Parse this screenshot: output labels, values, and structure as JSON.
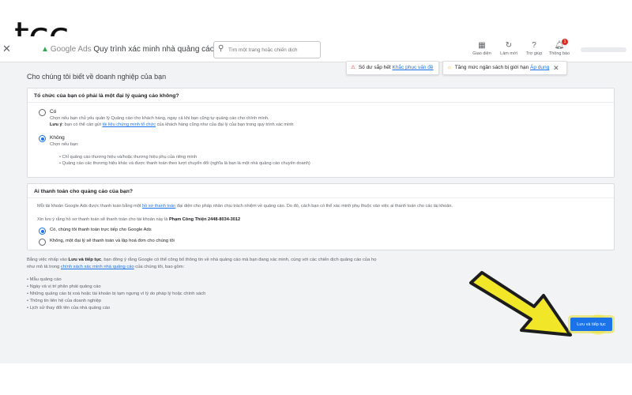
{
  "logo": "tcc",
  "appbar": {
    "brand": "Google Ads",
    "title": "Quy trình xác minh nhà quảng cáo",
    "search_placeholder": "Tìm một trang hoặc chiến dịch",
    "tools": [
      {
        "label": "Giao diện",
        "icon": "layout-icon"
      },
      {
        "label": "Làm mới",
        "icon": "refresh-icon"
      },
      {
        "label": "Trợ giúp",
        "icon": "help-icon"
      },
      {
        "label": "Thông báo",
        "icon": "bell-icon",
        "badge": "1"
      }
    ]
  },
  "alerts": {
    "balance": {
      "text": "Số dư sắp hết",
      "link": "Khắc phục vấn đề"
    },
    "budget": {
      "text": "Tăng mức ngân sách bị giới hạn",
      "link": "Áp dụng"
    }
  },
  "section_title": "Cho chúng tôi biết về doanh nghiệp của bạn",
  "card1": {
    "question": "Tổ chức của bạn có phải là một đại lý quảng cáo không?",
    "options": [
      {
        "label": "Có",
        "selected": false,
        "desc": "Chọn nếu bạn chủ yếu quản lý Quảng cáo cho khách hàng, ngay cả khi bạn cũng tự quảng cáo cho chính mình.",
        "note_label": "Lưu ý",
        "note_pre": ": bạn có thể cần gửi ",
        "note_link": "tài liệu chứng minh tổ chức",
        "note_post": " của khách hàng cũng như của đại lý của bạn trong quy trình xác minh"
      },
      {
        "label": "Không",
        "selected": true,
        "desc": "Chọn nếu bạn:",
        "bullets": [
          "• Chỉ quảng cáo thương hiệu và/hoặc thương hiệu phụ của riêng mình",
          "• Quảng cáo các thương hiệu khác và được thanh toán theo lượt chuyển đổi (nghĩa là bạn là một nhà quảng cáo chuyên doanh)"
        ]
      }
    ]
  },
  "card2": {
    "question": "Ai thanh toán cho quảng cáo của bạn?",
    "desc_pre": "Mỗi tài khoản Google Ads được thanh toán bằng một ",
    "desc_link": "hồ sơ thanh toán",
    "desc_post": " đại diện cho pháp nhân chịu trách nhiệm về quảng cáo. Do đó, cách bạn có thể xác minh phụ thuộc vào việc ai thanh toán cho các tài khoản.",
    "profile_pre": "Xin lưu ý rằng hồ sơ thanh toán sẽ thanh toán cho tài khoản này là ",
    "profile_name": "Phạm Công Thiện 2448-8034-3012",
    "options": [
      {
        "label": "Có, chúng tôi thanh toán trực tiếp cho Google Ads",
        "selected": true
      },
      {
        "label": "Không, một đại lý sẽ thanh toán và lập hoá đơn cho chúng tôi",
        "selected": false
      }
    ]
  },
  "consent": {
    "line1_pre": "Bằng việc nhấp vào ",
    "line1_bold": "Lưu và tiếp tục",
    "line1_post": ", bạn đồng ý rằng Google có thể công bố thông tin về nhà quảng cáo mà bạn đang xác minh, cùng với các chiến dịch quảng cáo của họ",
    "line2_pre": "như mô tả trong ",
    "line2_link": "chính sách xác minh nhà quảng cáo",
    "line2_post": " của chúng tôi, bao gồm:",
    "items": [
      "• Mẫu quảng cáo",
      "• Ngày và vị trí phân phát quảng cáo",
      "• Những quảng cáo bị xoá hoặc tài khoản bị tạm ngưng vì lý do pháp lý hoặc chính sách",
      "• Thông tin liên hệ của doanh nghiệp",
      "• Lịch sử thay đổi tên của nhà quảng cáo"
    ]
  },
  "save_button": "Lưu và tiếp tục",
  "colors": {
    "accent": "#1a73e8",
    "arrow": "#f2e629",
    "warning": "#d93025",
    "bulb": "#f9ab00"
  }
}
